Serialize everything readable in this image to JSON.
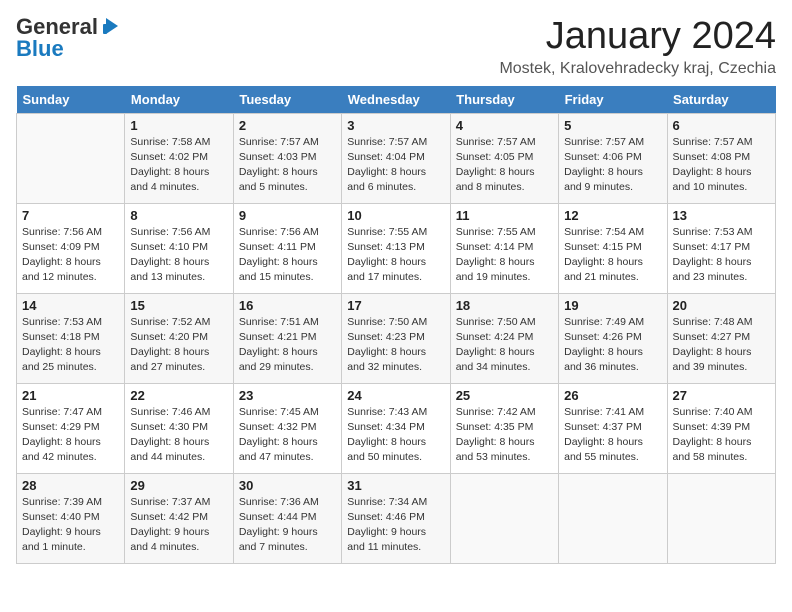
{
  "header": {
    "logo_general": "General",
    "logo_blue": "Blue",
    "title": "January 2024",
    "subtitle": "Mostek, Kralovehradecky kraj, Czechia"
  },
  "weekdays": [
    "Sunday",
    "Monday",
    "Tuesday",
    "Wednesday",
    "Thursday",
    "Friday",
    "Saturday"
  ],
  "weeks": [
    [
      {
        "day": "",
        "sunrise": "",
        "sunset": "",
        "daylight": ""
      },
      {
        "day": "1",
        "sunrise": "Sunrise: 7:58 AM",
        "sunset": "Sunset: 4:02 PM",
        "daylight": "Daylight: 8 hours and 4 minutes."
      },
      {
        "day": "2",
        "sunrise": "Sunrise: 7:57 AM",
        "sunset": "Sunset: 4:03 PM",
        "daylight": "Daylight: 8 hours and 5 minutes."
      },
      {
        "day": "3",
        "sunrise": "Sunrise: 7:57 AM",
        "sunset": "Sunset: 4:04 PM",
        "daylight": "Daylight: 8 hours and 6 minutes."
      },
      {
        "day": "4",
        "sunrise": "Sunrise: 7:57 AM",
        "sunset": "Sunset: 4:05 PM",
        "daylight": "Daylight: 8 hours and 8 minutes."
      },
      {
        "day": "5",
        "sunrise": "Sunrise: 7:57 AM",
        "sunset": "Sunset: 4:06 PM",
        "daylight": "Daylight: 8 hours and 9 minutes."
      },
      {
        "day": "6",
        "sunrise": "Sunrise: 7:57 AM",
        "sunset": "Sunset: 4:08 PM",
        "daylight": "Daylight: 8 hours and 10 minutes."
      }
    ],
    [
      {
        "day": "7",
        "sunrise": "Sunrise: 7:56 AM",
        "sunset": "Sunset: 4:09 PM",
        "daylight": "Daylight: 8 hours and 12 minutes."
      },
      {
        "day": "8",
        "sunrise": "Sunrise: 7:56 AM",
        "sunset": "Sunset: 4:10 PM",
        "daylight": "Daylight: 8 hours and 13 minutes."
      },
      {
        "day": "9",
        "sunrise": "Sunrise: 7:56 AM",
        "sunset": "Sunset: 4:11 PM",
        "daylight": "Daylight: 8 hours and 15 minutes."
      },
      {
        "day": "10",
        "sunrise": "Sunrise: 7:55 AM",
        "sunset": "Sunset: 4:13 PM",
        "daylight": "Daylight: 8 hours and 17 minutes."
      },
      {
        "day": "11",
        "sunrise": "Sunrise: 7:55 AM",
        "sunset": "Sunset: 4:14 PM",
        "daylight": "Daylight: 8 hours and 19 minutes."
      },
      {
        "day": "12",
        "sunrise": "Sunrise: 7:54 AM",
        "sunset": "Sunset: 4:15 PM",
        "daylight": "Daylight: 8 hours and 21 minutes."
      },
      {
        "day": "13",
        "sunrise": "Sunrise: 7:53 AM",
        "sunset": "Sunset: 4:17 PM",
        "daylight": "Daylight: 8 hours and 23 minutes."
      }
    ],
    [
      {
        "day": "14",
        "sunrise": "Sunrise: 7:53 AM",
        "sunset": "Sunset: 4:18 PM",
        "daylight": "Daylight: 8 hours and 25 minutes."
      },
      {
        "day": "15",
        "sunrise": "Sunrise: 7:52 AM",
        "sunset": "Sunset: 4:20 PM",
        "daylight": "Daylight: 8 hours and 27 minutes."
      },
      {
        "day": "16",
        "sunrise": "Sunrise: 7:51 AM",
        "sunset": "Sunset: 4:21 PM",
        "daylight": "Daylight: 8 hours and 29 minutes."
      },
      {
        "day": "17",
        "sunrise": "Sunrise: 7:50 AM",
        "sunset": "Sunset: 4:23 PM",
        "daylight": "Daylight: 8 hours and 32 minutes."
      },
      {
        "day": "18",
        "sunrise": "Sunrise: 7:50 AM",
        "sunset": "Sunset: 4:24 PM",
        "daylight": "Daylight: 8 hours and 34 minutes."
      },
      {
        "day": "19",
        "sunrise": "Sunrise: 7:49 AM",
        "sunset": "Sunset: 4:26 PM",
        "daylight": "Daylight: 8 hours and 36 minutes."
      },
      {
        "day": "20",
        "sunrise": "Sunrise: 7:48 AM",
        "sunset": "Sunset: 4:27 PM",
        "daylight": "Daylight: 8 hours and 39 minutes."
      }
    ],
    [
      {
        "day": "21",
        "sunrise": "Sunrise: 7:47 AM",
        "sunset": "Sunset: 4:29 PM",
        "daylight": "Daylight: 8 hours and 42 minutes."
      },
      {
        "day": "22",
        "sunrise": "Sunrise: 7:46 AM",
        "sunset": "Sunset: 4:30 PM",
        "daylight": "Daylight: 8 hours and 44 minutes."
      },
      {
        "day": "23",
        "sunrise": "Sunrise: 7:45 AM",
        "sunset": "Sunset: 4:32 PM",
        "daylight": "Daylight: 8 hours and 47 minutes."
      },
      {
        "day": "24",
        "sunrise": "Sunrise: 7:43 AM",
        "sunset": "Sunset: 4:34 PM",
        "daylight": "Daylight: 8 hours and 50 minutes."
      },
      {
        "day": "25",
        "sunrise": "Sunrise: 7:42 AM",
        "sunset": "Sunset: 4:35 PM",
        "daylight": "Daylight: 8 hours and 53 minutes."
      },
      {
        "day": "26",
        "sunrise": "Sunrise: 7:41 AM",
        "sunset": "Sunset: 4:37 PM",
        "daylight": "Daylight: 8 hours and 55 minutes."
      },
      {
        "day": "27",
        "sunrise": "Sunrise: 7:40 AM",
        "sunset": "Sunset: 4:39 PM",
        "daylight": "Daylight: 8 hours and 58 minutes."
      }
    ],
    [
      {
        "day": "28",
        "sunrise": "Sunrise: 7:39 AM",
        "sunset": "Sunset: 4:40 PM",
        "daylight": "Daylight: 9 hours and 1 minute."
      },
      {
        "day": "29",
        "sunrise": "Sunrise: 7:37 AM",
        "sunset": "Sunset: 4:42 PM",
        "daylight": "Daylight: 9 hours and 4 minutes."
      },
      {
        "day": "30",
        "sunrise": "Sunrise: 7:36 AM",
        "sunset": "Sunset: 4:44 PM",
        "daylight": "Daylight: 9 hours and 7 minutes."
      },
      {
        "day": "31",
        "sunrise": "Sunrise: 7:34 AM",
        "sunset": "Sunset: 4:46 PM",
        "daylight": "Daylight: 9 hours and 11 minutes."
      },
      {
        "day": "",
        "sunrise": "",
        "sunset": "",
        "daylight": ""
      },
      {
        "day": "",
        "sunrise": "",
        "sunset": "",
        "daylight": ""
      },
      {
        "day": "",
        "sunrise": "",
        "sunset": "",
        "daylight": ""
      }
    ]
  ]
}
